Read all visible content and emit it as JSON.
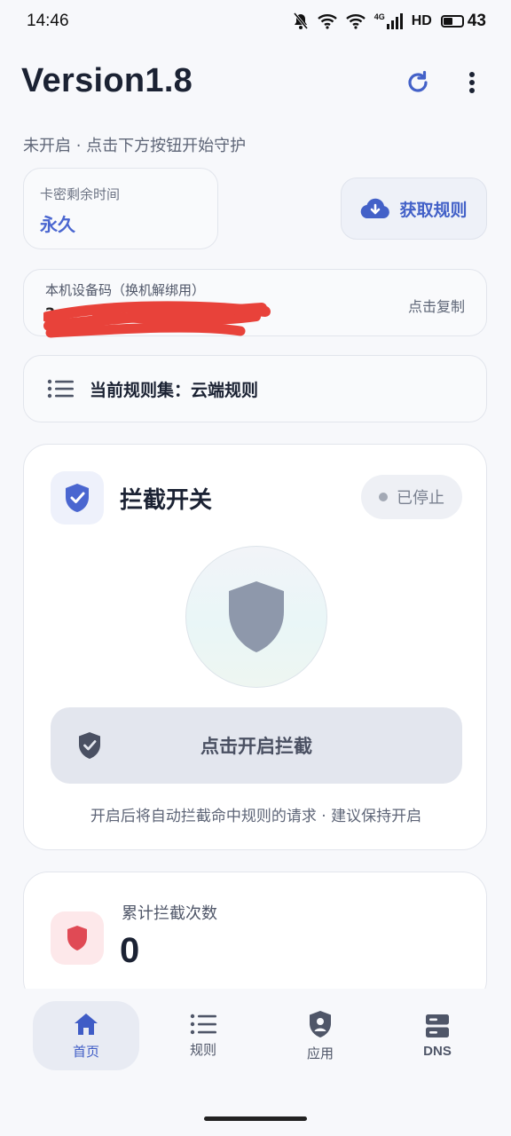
{
  "status_bar": {
    "time": "14:46",
    "network_label": "4G",
    "hd_label": "HD",
    "battery_level": "43"
  },
  "header": {
    "title": "Version1.8"
  },
  "status_message": "未开启 · 点击下方按钮开始守护",
  "license": {
    "label": "卡密剩余时间",
    "value": "永久"
  },
  "get_rules_label": "获取规则",
  "device": {
    "label": "本机设备码（换机解绑用）",
    "code_visible": "2",
    "copy_label": "点击复制"
  },
  "ruleset": {
    "text": "当前规则集：云端规则"
  },
  "switch_card": {
    "title": "拦截开关",
    "state": "已停止",
    "start_button": "点击开启拦截",
    "hint": "开启后将自动拦截命中规则的请求 · 建议保持开启"
  },
  "stats": {
    "label": "累计拦截次数",
    "value": "0"
  },
  "nav": {
    "items": [
      {
        "label": "首页",
        "icon": "home-icon",
        "active": true
      },
      {
        "label": "规则",
        "icon": "list-icon",
        "active": false
      },
      {
        "label": "应用",
        "icon": "shield-user-icon",
        "active": false
      },
      {
        "label": "DNS",
        "icon": "server-icon",
        "active": false
      }
    ]
  },
  "colors": {
    "accent": "#4361c8",
    "background": "#f7f8fb",
    "danger_bg": "#fde8ea",
    "danger": "#e04a55"
  }
}
